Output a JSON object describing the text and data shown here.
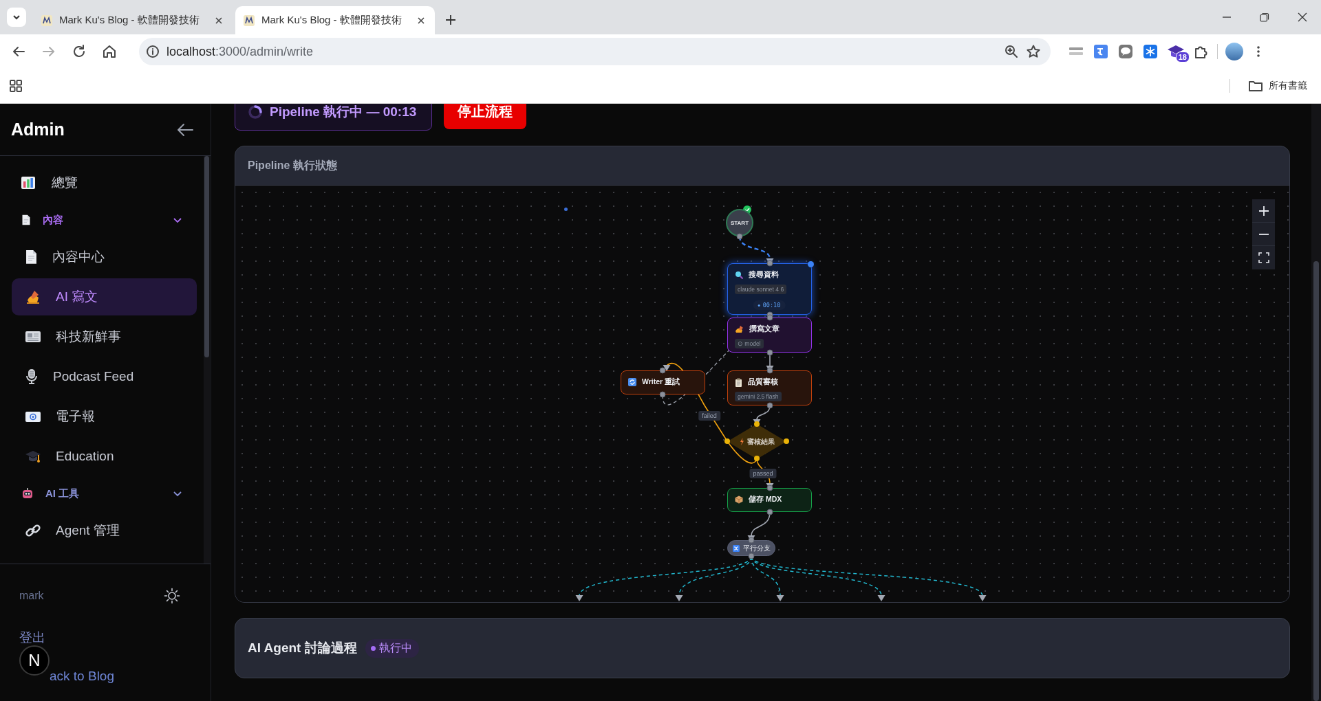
{
  "browser": {
    "tabs": [
      {
        "title": "Mark Ku's Blog - 軟體開發技術",
        "selected": false
      },
      {
        "title": "Mark Ku's Blog - 軟體開發技術",
        "selected": true
      }
    ],
    "url_host": "localhost",
    "url_path": ":3000/admin/write",
    "extension_badge": "18",
    "bookmarks_folder": "所有書籤"
  },
  "sidebar": {
    "title": "Admin",
    "items": [
      {
        "kind": "link",
        "label": "總覽",
        "selected": false
      },
      {
        "kind": "group",
        "label": "內容",
        "active": true,
        "expanded": true,
        "children": [
          {
            "label": "內容中心",
            "selected": false
          },
          {
            "label": "AI 寫文",
            "selected": true
          },
          {
            "label": "科技新鮮事",
            "selected": false
          },
          {
            "label": "Podcast Feed",
            "selected": false
          },
          {
            "label": "電子報",
            "selected": false
          },
          {
            "label": "Education",
            "selected": false
          }
        ]
      },
      {
        "kind": "group",
        "label": "AI 工具",
        "active": false,
        "expanded": true,
        "children": [
          {
            "label": "Agent 管理",
            "selected": false
          }
        ]
      }
    ],
    "user": "mark",
    "logout": "登出",
    "back_link": "ack to Blog",
    "dev_badge": "N"
  },
  "run_status": {
    "label": "Pipeline 執行中 — 00:13",
    "running": true
  },
  "stop_button": "停止流程",
  "pipeline": {
    "title": "Pipeline 執行狀態",
    "nodes": [
      {
        "kind": "start",
        "label": "START",
        "color": "#2f7a55",
        "done": true,
        "running": false
      },
      {
        "kind": "task",
        "label": "搜尋資料",
        "model": "claude sonnet 4 6",
        "color": "#2563eb",
        "done": false,
        "running": true,
        "timer": "00:10"
      },
      {
        "kind": "task",
        "label": "撰寫文章",
        "model": "⊙ model",
        "color": "#9333ea",
        "done": false,
        "running": false
      },
      {
        "kind": "task",
        "label": "Writer 重試",
        "color": "#c2410c",
        "done": false,
        "running": false
      },
      {
        "kind": "task",
        "label": "品質審核",
        "model": "gemini 2.5 flash",
        "color": "#c2410c",
        "done": false,
        "running": false
      },
      {
        "kind": "decision",
        "label": "審核結果",
        "color": "#eab308",
        "done": false,
        "running": false
      },
      {
        "kind": "task",
        "label": "儲存 MDX",
        "color": "#16a34a",
        "done": false,
        "running": false
      },
      {
        "kind": "branch",
        "label": "平行分支",
        "color": "#5b6075",
        "done": false,
        "running": false
      }
    ],
    "edges": [
      {
        "kind": "active"
      },
      {
        "kind": "normal"
      },
      {
        "kind": "retry"
      },
      {
        "kind": "normal"
      },
      {
        "kind": "normal"
      },
      {
        "kind": "failed",
        "label": "failed"
      },
      {
        "kind": "passed",
        "label": "passed"
      },
      {
        "kind": "normal"
      },
      {
        "kind": "parallel"
      },
      {
        "kind": "parallel"
      },
      {
        "kind": "parallel"
      },
      {
        "kind": "parallel"
      },
      {
        "kind": "parallel"
      }
    ]
  },
  "agent_panel": {
    "title": "AI Agent 討論過程",
    "status": "執行中"
  }
}
